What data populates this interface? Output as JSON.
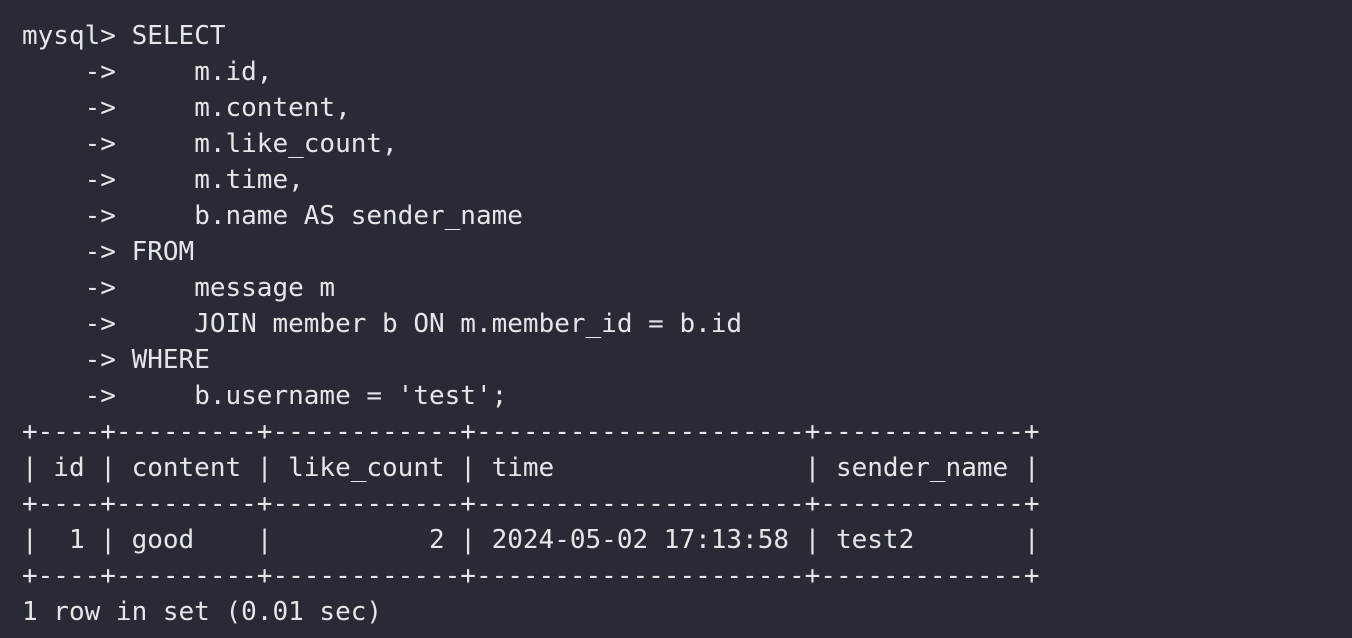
{
  "terminal": {
    "prompt": "mysql> ",
    "continuation": "    -> ",
    "query_lines": [
      "SELECT",
      "    m.id,",
      "    m.content,",
      "    m.like_count,",
      "    m.time,",
      "    b.name AS sender_name",
      "FROM",
      "    message m",
      "    JOIN member b ON m.member_id = b.id",
      "WHERE",
      "    b.username = 'test';"
    ],
    "result": {
      "border": "+----+---------+------------+---------------------+-------------+",
      "header_row": "| id | content | like_count | time                | sender_name |",
      "rows": [
        "|  1 | good    |          2 | 2024-05-02 17:13:58 | test2       |"
      ],
      "columns": [
        "id",
        "content",
        "like_count",
        "time",
        "sender_name"
      ],
      "data": [
        {
          "id": "1",
          "content": "good",
          "like_count": "2",
          "time": "2024-05-02 17:13:58",
          "sender_name": "test2"
        }
      ]
    },
    "footer": "1 row in set (0.01 sec)"
  },
  "colors": {
    "background": "#282a36",
    "text": "#e6e6e6"
  }
}
